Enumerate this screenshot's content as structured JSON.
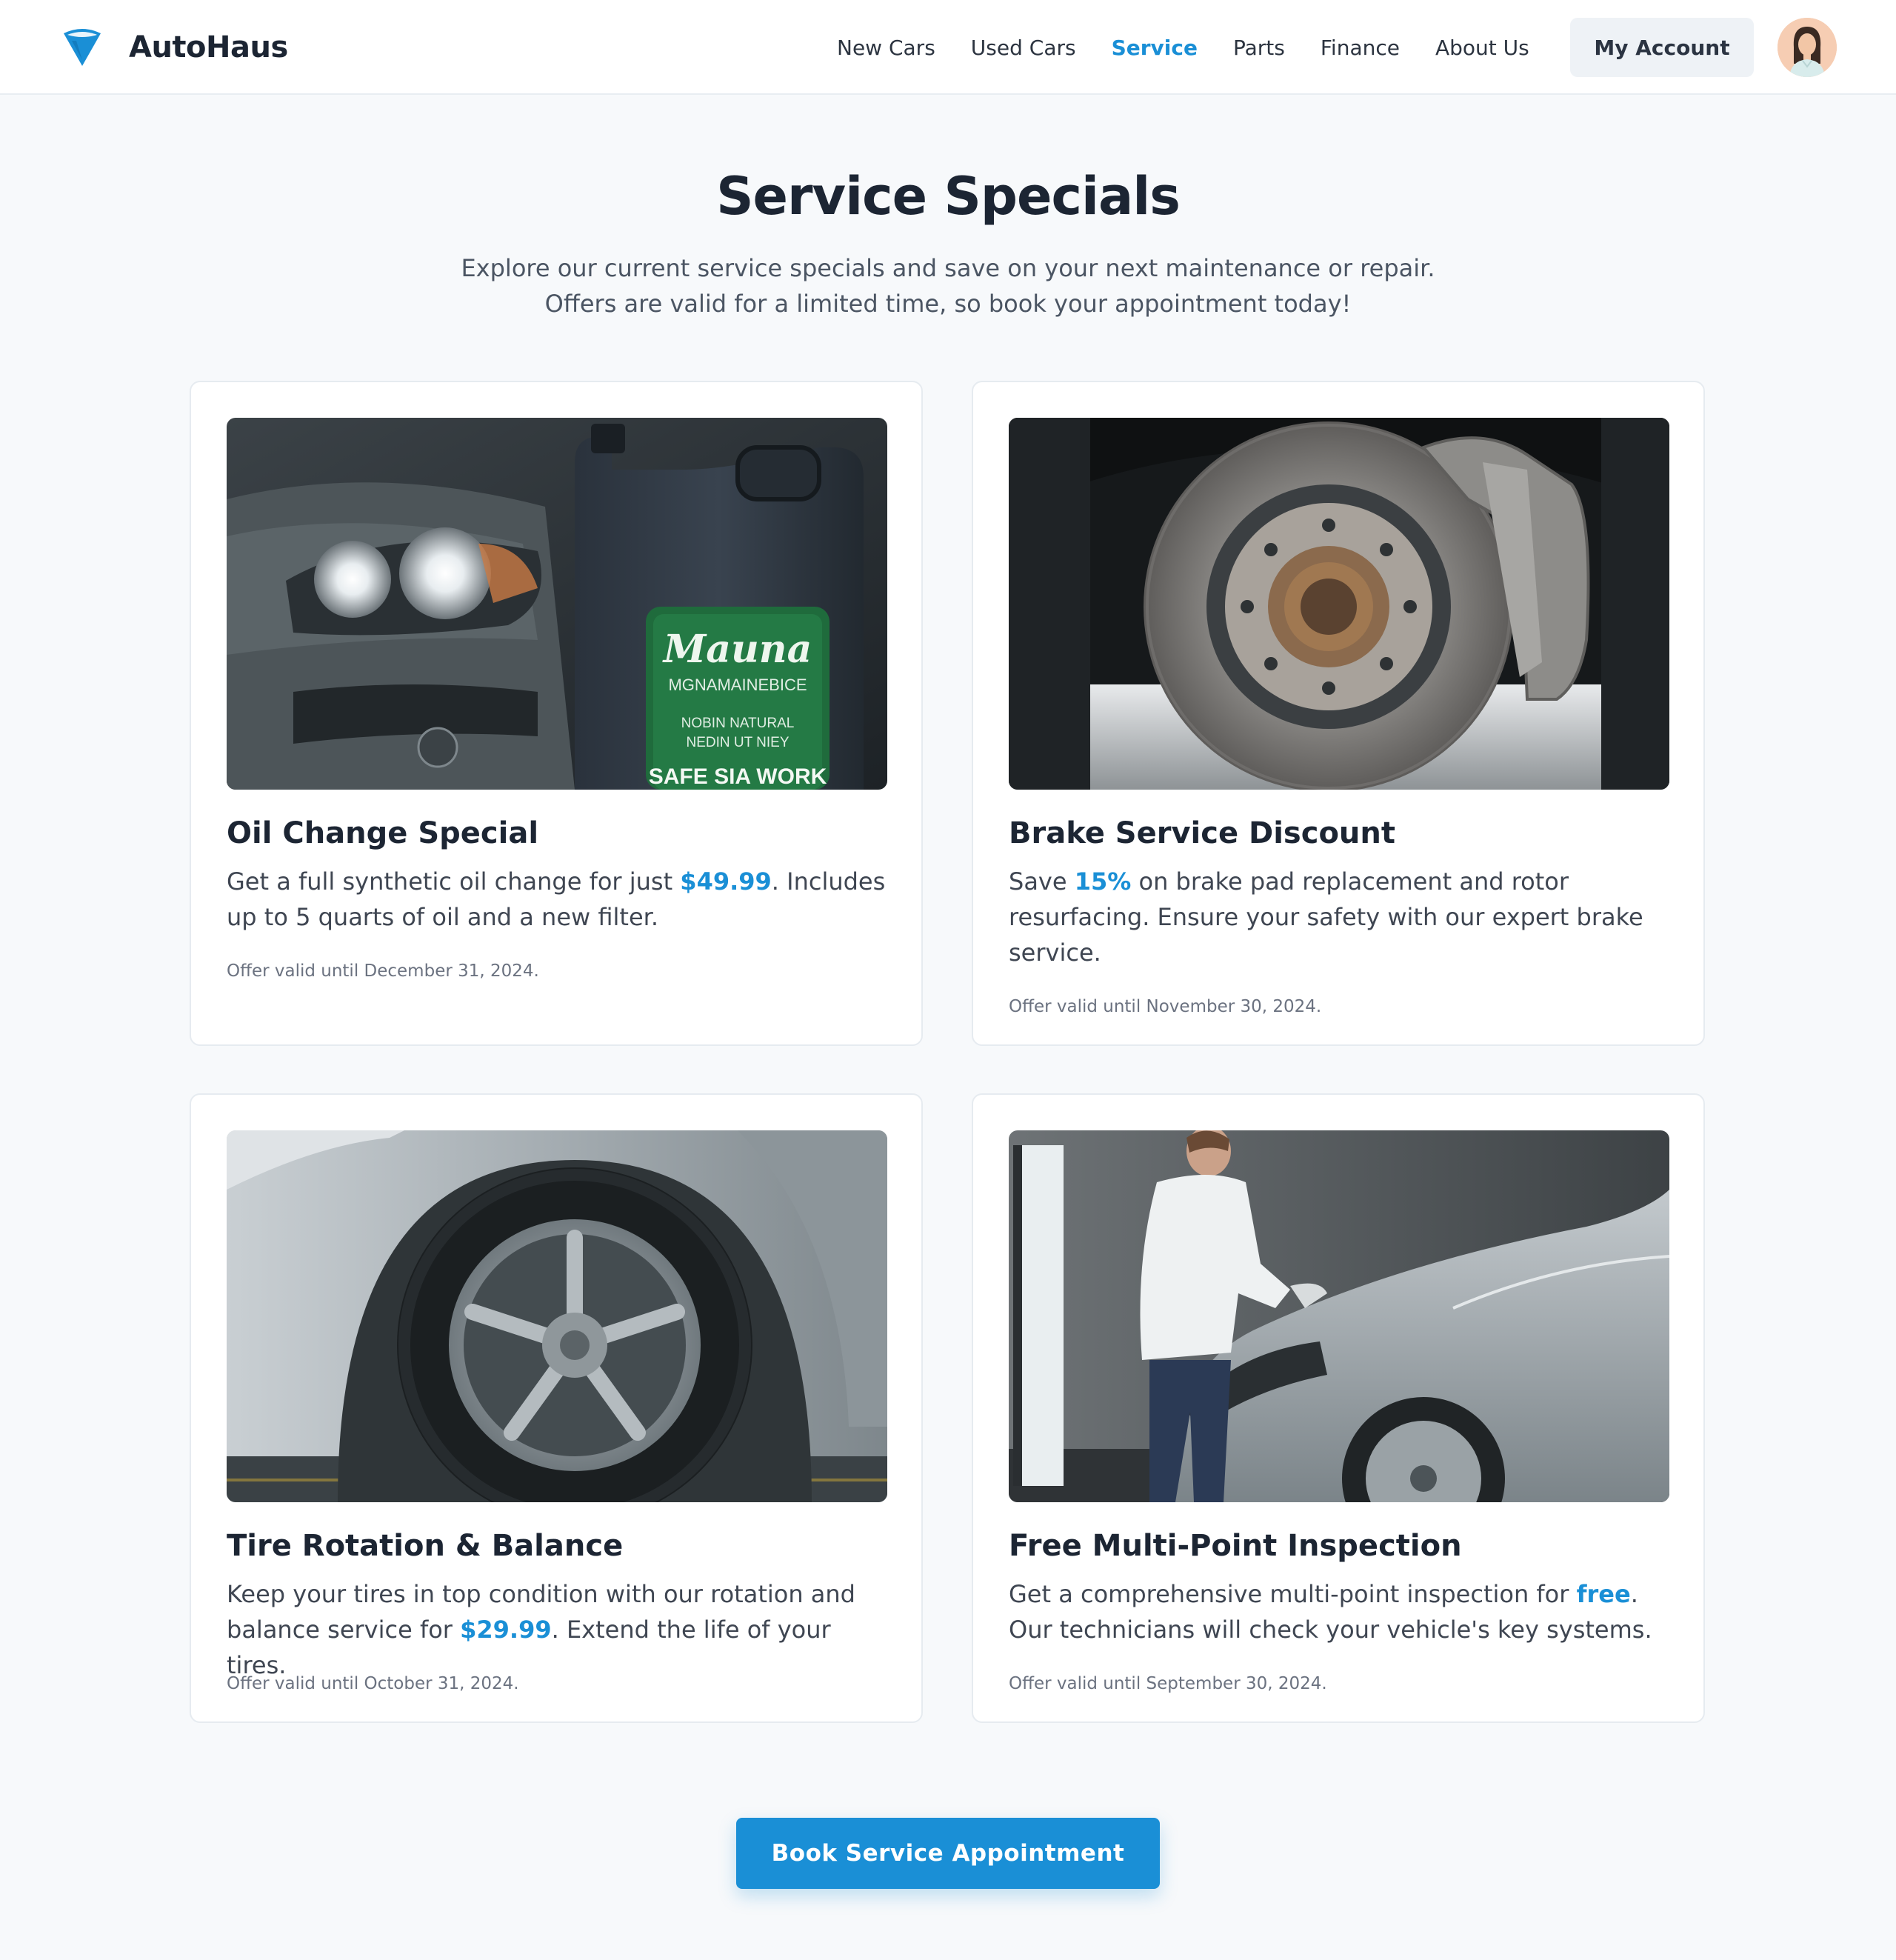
{
  "brand": {
    "name": "AutoHaus"
  },
  "nav": {
    "items": [
      {
        "label": "New Cars",
        "active": false
      },
      {
        "label": "Used Cars",
        "active": false
      },
      {
        "label": "Service",
        "active": true
      },
      {
        "label": "Parts",
        "active": false
      },
      {
        "label": "Finance",
        "active": false
      },
      {
        "label": "About Us",
        "active": false
      }
    ],
    "account_label": "My Account"
  },
  "hero": {
    "title": "Service Specials",
    "subtitle_line1": "Explore our current service specials and save on your next maintenance or repair.",
    "subtitle_line2": "Offers are valid for a limited time, so book your appointment today!"
  },
  "offers": [
    {
      "title": "Oil Change Special",
      "desc_pre": "Get a full synthetic oil change for just ",
      "highlight": "$49.99",
      "desc_post": ". Includes up to 5 quarts of oil and a new filter.",
      "valid": "Offer valid until December 31, 2024.",
      "image_label": {
        "line1": "Mauna",
        "line2": "MGNAMAINEBICE",
        "line3": "NOBIN NATURAL",
        "line4": "NEDIN UT NIEY",
        "line5": "SAFE SIA WORK"
      }
    },
    {
      "title": "Brake Service Discount",
      "desc_pre": "Save ",
      "highlight": "15%",
      "desc_post": " on brake pad replacement and rotor resurfacing. Ensure your safety with our expert brake service.",
      "valid": "Offer valid until November 30, 2024."
    },
    {
      "title": "Tire Rotation & Balance",
      "desc_pre": "Keep your tires in top condition with our rotation and balance service for ",
      "highlight": "$29.99",
      "desc_post": ". Extend the life of your tires.",
      "valid": "Offer valid until October 31, 2024."
    },
    {
      "title": "Free Multi-Point Inspection",
      "desc_pre": "Get a comprehensive multi-point inspection for ",
      "highlight": "free",
      "desc_post": ". Our technicians will check your vehicle's key systems.",
      "valid": "Offer valid until September 30, 2024."
    }
  ],
  "cta": {
    "label": "Book Service Appointment"
  },
  "colors": {
    "accent": "#1a8fd6",
    "page_bg": "#f7f9fb",
    "heading": "#1c2533"
  }
}
